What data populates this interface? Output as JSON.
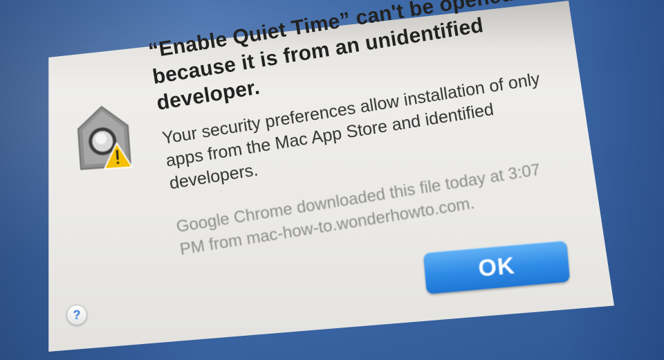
{
  "dialog": {
    "headline": [
      "“Enable Quiet Time” can't be opened",
      "because it is from an unidentified",
      "developer."
    ],
    "info": [
      "Your security preferences allow installation of only",
      "apps from the Mac App Store and identified",
      "developers."
    ],
    "download_note": [
      "Google Chrome downloaded this file today at 3:07",
      "PM from mac-how-to.wonderhowto.com."
    ],
    "ok_label": "OK",
    "help_label": "?",
    "icons": {
      "app": "gatekeeper-lock-icon",
      "warning": "warning-triangle-icon"
    }
  },
  "colors": {
    "accent": "#2f8be6",
    "warning": "#f5c000",
    "desktop": "#3f6aa8"
  }
}
